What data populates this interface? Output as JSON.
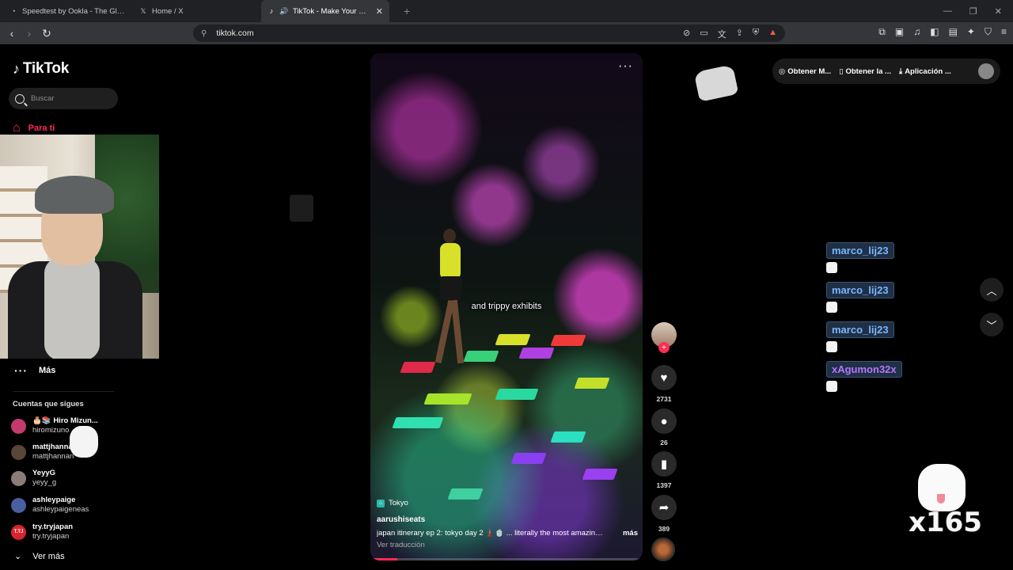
{
  "browser": {
    "tabs": [
      {
        "title": "Speedtest by Ookla - The Global Broadband",
        "icon": "speedtest-icon"
      },
      {
        "title": "Home / X",
        "icon": "x-icon"
      },
      {
        "title": "TikTok - Make Your Day",
        "icon": "tiktok-icon"
      }
    ],
    "url": "tiktok.com"
  },
  "sidebar": {
    "brand": "TikTok",
    "search_placeholder": "Buscar",
    "for_you": "Para ti",
    "more": "Más",
    "following_title": "Cuentas que sigues",
    "accounts": [
      {
        "name": "Hiro Mizun...",
        "handle": "hiromizuno",
        "avatar_color": "#c43a6e",
        "prefix": "🎂📚"
      },
      {
        "name": "mattjhannan",
        "handle": "mattjhannan",
        "avatar_color": "#5a4636"
      },
      {
        "name": "YeyyG",
        "handle": "yeyy_g",
        "avatar_color": "#8a7d78"
      },
      {
        "name": "ashleypaige",
        "handle": "ashleypaigeneas",
        "avatar_color": "#4a5fa0"
      },
      {
        "name": "try.tryjapan",
        "handle": "try.tryjapan",
        "avatar_color": "#d9232d",
        "initials": "T.TJ"
      }
    ],
    "see_more": "Ver más"
  },
  "video": {
    "subtitle": "and trippy exhibits",
    "location": "Tokyo",
    "author": "aarushiseats",
    "description": "japan itinerary ep 2: tokyo day 2 🗼🍵 ... literally the most amazing d...",
    "more_label": "más",
    "translate_label": "Ver traducción",
    "progress": 0.1
  },
  "actions": {
    "likes": "2731",
    "comments": "26",
    "saves": "1397",
    "shares": "389"
  },
  "header_right": {
    "item1": "Obtener M...",
    "item2": "Obtener la ...",
    "item3": "Aplicación ..."
  },
  "chat": [
    {
      "user": "marco_lij23",
      "color": "#7ab7ff"
    },
    {
      "user": "marco_lij23",
      "color": "#7ab7ff"
    },
    {
      "user": "marco_lij23",
      "color": "#7ab7ff"
    },
    {
      "user": "xAgumon32x",
      "color": "#b776ff"
    }
  ],
  "overlay_counter": "x165",
  "colors": {
    "accent": "#fe2c55",
    "background": "#000000"
  }
}
